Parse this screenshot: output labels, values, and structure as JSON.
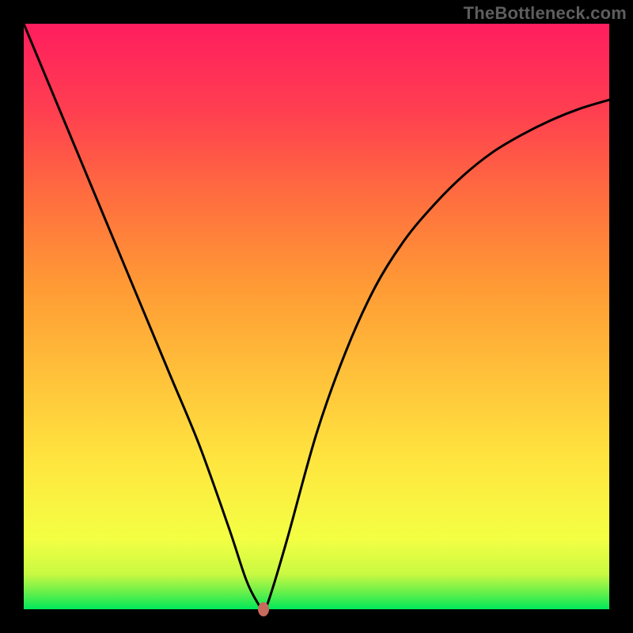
{
  "watermark": "TheBottleneck.com",
  "chart_data": {
    "type": "line",
    "title": "",
    "xlabel": "",
    "ylabel": "",
    "xlim": [
      0,
      100
    ],
    "ylim": [
      0,
      100
    ],
    "x": [
      0,
      5,
      10,
      15,
      20,
      25,
      30,
      35,
      38,
      40,
      41,
      42,
      45,
      50,
      55,
      60,
      65,
      70,
      75,
      80,
      85,
      90,
      95,
      100
    ],
    "values": [
      100,
      88,
      76,
      64,
      52,
      40,
      28,
      14,
      5,
      1,
      0,
      2,
      12,
      30,
      44,
      55,
      63,
      69,
      74,
      78,
      81,
      83.5,
      85.5,
      87
    ],
    "marker": {
      "x": 41,
      "y": 0,
      "color": "#c96a5f"
    },
    "background_gradient": {
      "direction": "vertical",
      "stops": [
        {
          "pos": 0.0,
          "color": "#00e85a"
        },
        {
          "pos": 0.03,
          "color": "#6bf04a"
        },
        {
          "pos": 0.06,
          "color": "#c9f942"
        },
        {
          "pos": 0.12,
          "color": "#f3ff43"
        },
        {
          "pos": 0.25,
          "color": "#ffe63f"
        },
        {
          "pos": 0.4,
          "color": "#ffc13a"
        },
        {
          "pos": 0.55,
          "color": "#ff9b35"
        },
        {
          "pos": 0.7,
          "color": "#ff6f3e"
        },
        {
          "pos": 0.85,
          "color": "#ff3f50"
        },
        {
          "pos": 1.0,
          "color": "#ff1d5e"
        }
      ]
    },
    "curve_color": "#000000",
    "curve_width": 3
  }
}
